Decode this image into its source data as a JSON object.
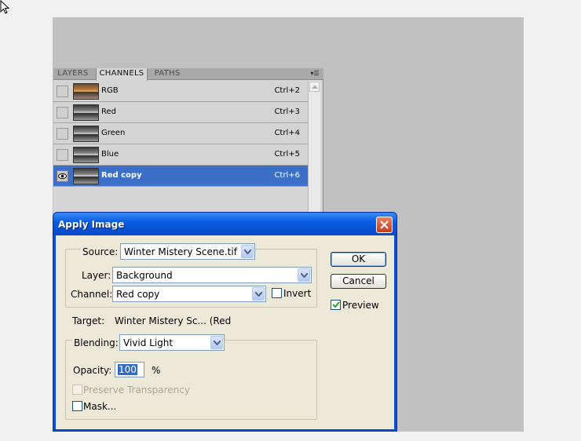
{
  "panel": {
    "tabs": [
      {
        "label": "LAYERS"
      },
      {
        "label": "CHANNELS"
      },
      {
        "label": "PATHS"
      }
    ],
    "menu_icon": "panel-menu-icon",
    "channels": [
      {
        "name": "RGB",
        "shortcut": "Ctrl+2",
        "visible": false,
        "selected": false
      },
      {
        "name": "Red",
        "shortcut": "Ctrl+3",
        "visible": false,
        "selected": false
      },
      {
        "name": "Green",
        "shortcut": "Ctrl+4",
        "visible": false,
        "selected": false
      },
      {
        "name": "Blue",
        "shortcut": "Ctrl+5",
        "visible": false,
        "selected": false
      },
      {
        "name": "Red copy",
        "shortcut": "Ctrl+6",
        "visible": true,
        "selected": true
      }
    ]
  },
  "dialog": {
    "title": "Apply Image",
    "source_label": "Source:",
    "source_value": "Winter Mistery Scene.tif",
    "layer_label": "Layer:",
    "layer_value": "Background",
    "channel_label": "Channel:",
    "channel_value": "Red copy",
    "invert_label": "Invert",
    "invert_checked": false,
    "target_label": "Target:",
    "target_value": "Winter Mistery Sc... (Red",
    "blending_label": "Blending:",
    "blending_value": "Vivid Light",
    "opacity_label": "Opacity:",
    "opacity_value": "100",
    "opacity_unit": "%",
    "preserve_label": "Preserve Transparency",
    "preserve_checked": false,
    "mask_label": "Mask...",
    "mask_checked": false,
    "ok_label": "OK",
    "cancel_label": "Cancel",
    "preview_label": "Preview",
    "preview_checked": true
  },
  "colors": {
    "selection": "#3b6fc8",
    "title_bar": "#0a5ce0",
    "close_button": "#c93a18",
    "dialog_face": "#ece9d8",
    "canvas": "#c1c1c1"
  }
}
